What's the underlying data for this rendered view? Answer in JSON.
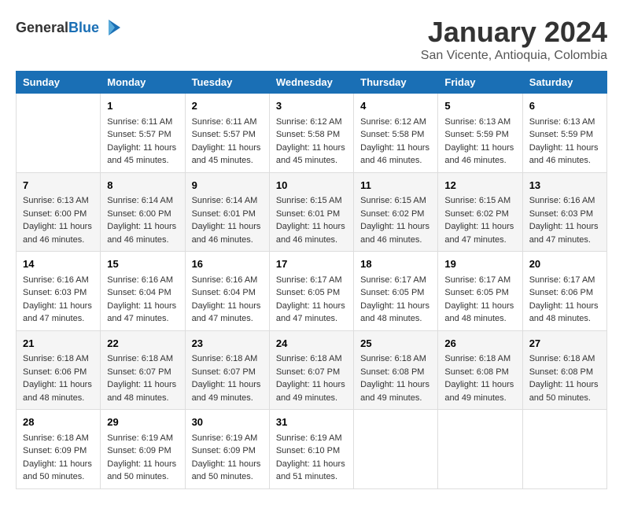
{
  "header": {
    "logo_general": "General",
    "logo_blue": "Blue",
    "title": "January 2024",
    "subtitle": "San Vicente, Antioquia, Colombia"
  },
  "days_of_week": [
    "Sunday",
    "Monday",
    "Tuesday",
    "Wednesday",
    "Thursday",
    "Friday",
    "Saturday"
  ],
  "weeks": [
    [
      {
        "day": "",
        "info": ""
      },
      {
        "day": "1",
        "info": "Sunrise: 6:11 AM\nSunset: 5:57 PM\nDaylight: 11 hours\nand 45 minutes."
      },
      {
        "day": "2",
        "info": "Sunrise: 6:11 AM\nSunset: 5:57 PM\nDaylight: 11 hours\nand 45 minutes."
      },
      {
        "day": "3",
        "info": "Sunrise: 6:12 AM\nSunset: 5:58 PM\nDaylight: 11 hours\nand 45 minutes."
      },
      {
        "day": "4",
        "info": "Sunrise: 6:12 AM\nSunset: 5:58 PM\nDaylight: 11 hours\nand 46 minutes."
      },
      {
        "day": "5",
        "info": "Sunrise: 6:13 AM\nSunset: 5:59 PM\nDaylight: 11 hours\nand 46 minutes."
      },
      {
        "day": "6",
        "info": "Sunrise: 6:13 AM\nSunset: 5:59 PM\nDaylight: 11 hours\nand 46 minutes."
      }
    ],
    [
      {
        "day": "7",
        "info": "Sunrise: 6:13 AM\nSunset: 6:00 PM\nDaylight: 11 hours\nand 46 minutes."
      },
      {
        "day": "8",
        "info": "Sunrise: 6:14 AM\nSunset: 6:00 PM\nDaylight: 11 hours\nand 46 minutes."
      },
      {
        "day": "9",
        "info": "Sunrise: 6:14 AM\nSunset: 6:01 PM\nDaylight: 11 hours\nand 46 minutes."
      },
      {
        "day": "10",
        "info": "Sunrise: 6:15 AM\nSunset: 6:01 PM\nDaylight: 11 hours\nand 46 minutes."
      },
      {
        "day": "11",
        "info": "Sunrise: 6:15 AM\nSunset: 6:02 PM\nDaylight: 11 hours\nand 46 minutes."
      },
      {
        "day": "12",
        "info": "Sunrise: 6:15 AM\nSunset: 6:02 PM\nDaylight: 11 hours\nand 47 minutes."
      },
      {
        "day": "13",
        "info": "Sunrise: 6:16 AM\nSunset: 6:03 PM\nDaylight: 11 hours\nand 47 minutes."
      }
    ],
    [
      {
        "day": "14",
        "info": "Sunrise: 6:16 AM\nSunset: 6:03 PM\nDaylight: 11 hours\nand 47 minutes."
      },
      {
        "day": "15",
        "info": "Sunrise: 6:16 AM\nSunset: 6:04 PM\nDaylight: 11 hours\nand 47 minutes."
      },
      {
        "day": "16",
        "info": "Sunrise: 6:16 AM\nSunset: 6:04 PM\nDaylight: 11 hours\nand 47 minutes."
      },
      {
        "day": "17",
        "info": "Sunrise: 6:17 AM\nSunset: 6:05 PM\nDaylight: 11 hours\nand 47 minutes."
      },
      {
        "day": "18",
        "info": "Sunrise: 6:17 AM\nSunset: 6:05 PM\nDaylight: 11 hours\nand 48 minutes."
      },
      {
        "day": "19",
        "info": "Sunrise: 6:17 AM\nSunset: 6:05 PM\nDaylight: 11 hours\nand 48 minutes."
      },
      {
        "day": "20",
        "info": "Sunrise: 6:17 AM\nSunset: 6:06 PM\nDaylight: 11 hours\nand 48 minutes."
      }
    ],
    [
      {
        "day": "21",
        "info": "Sunrise: 6:18 AM\nSunset: 6:06 PM\nDaylight: 11 hours\nand 48 minutes."
      },
      {
        "day": "22",
        "info": "Sunrise: 6:18 AM\nSunset: 6:07 PM\nDaylight: 11 hours\nand 48 minutes."
      },
      {
        "day": "23",
        "info": "Sunrise: 6:18 AM\nSunset: 6:07 PM\nDaylight: 11 hours\nand 49 minutes."
      },
      {
        "day": "24",
        "info": "Sunrise: 6:18 AM\nSunset: 6:07 PM\nDaylight: 11 hours\nand 49 minutes."
      },
      {
        "day": "25",
        "info": "Sunrise: 6:18 AM\nSunset: 6:08 PM\nDaylight: 11 hours\nand 49 minutes."
      },
      {
        "day": "26",
        "info": "Sunrise: 6:18 AM\nSunset: 6:08 PM\nDaylight: 11 hours\nand 49 minutes."
      },
      {
        "day": "27",
        "info": "Sunrise: 6:18 AM\nSunset: 6:08 PM\nDaylight: 11 hours\nand 50 minutes."
      }
    ],
    [
      {
        "day": "28",
        "info": "Sunrise: 6:18 AM\nSunset: 6:09 PM\nDaylight: 11 hours\nand 50 minutes."
      },
      {
        "day": "29",
        "info": "Sunrise: 6:19 AM\nSunset: 6:09 PM\nDaylight: 11 hours\nand 50 minutes."
      },
      {
        "day": "30",
        "info": "Sunrise: 6:19 AM\nSunset: 6:09 PM\nDaylight: 11 hours\nand 50 minutes."
      },
      {
        "day": "31",
        "info": "Sunrise: 6:19 AM\nSunset: 6:10 PM\nDaylight: 11 hours\nand 51 minutes."
      },
      {
        "day": "",
        "info": ""
      },
      {
        "day": "",
        "info": ""
      },
      {
        "day": "",
        "info": ""
      }
    ]
  ]
}
